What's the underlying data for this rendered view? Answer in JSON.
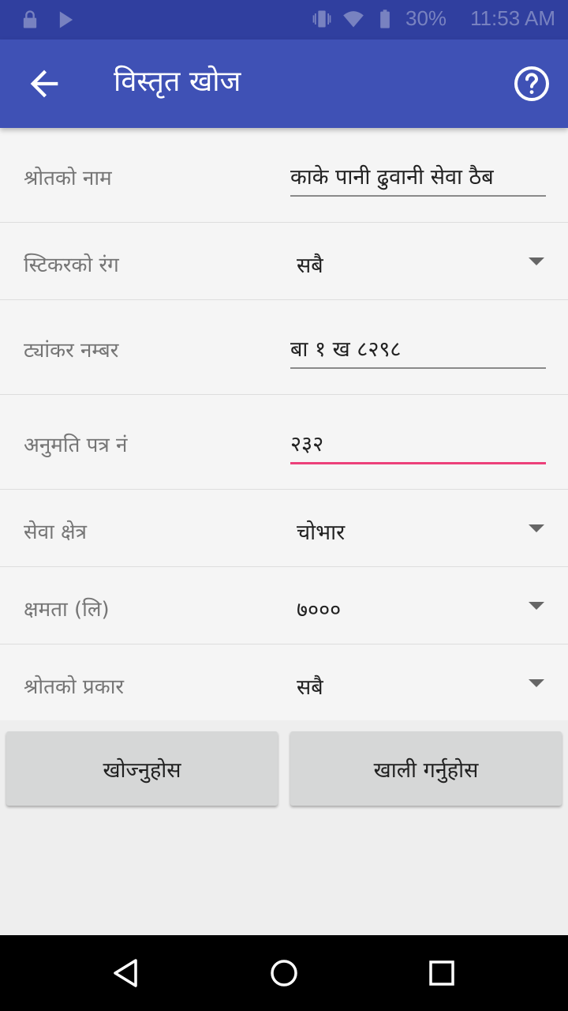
{
  "status_bar": {
    "battery": "30%",
    "time": "11:53 AM"
  },
  "app_bar": {
    "title": "विस्तृत खोज",
    "back_icon": "arrow-back-icon",
    "help_icon": "help-circle-icon"
  },
  "form": {
    "source_name": {
      "label": "श्रोतको नाम",
      "value": "काके पानी ढुवानी सेवा ठैब"
    },
    "sticker_color": {
      "label": "स्टिकरको रंग",
      "value": "सबै"
    },
    "tanker_number": {
      "label": "ट्यांकर नम्बर",
      "value": "बा १ ख ८२९८"
    },
    "permit_number": {
      "label": "अनुमति पत्र नं",
      "value": "२३२"
    },
    "service_area": {
      "label": "सेवा क्षेत्र",
      "value": "चोभार"
    },
    "capacity": {
      "label": "क्षमता (लि)",
      "value": "७०००"
    },
    "source_type": {
      "label": "श्रोतको प्रकार",
      "value": "सबै"
    }
  },
  "buttons": {
    "search": "खोज्नुहोस",
    "clear": "खाली गर्नुहोस"
  },
  "colors": {
    "status_bar": "#303f9f",
    "app_bar": "#3f51b5",
    "focus_underline": "#ec407a"
  }
}
